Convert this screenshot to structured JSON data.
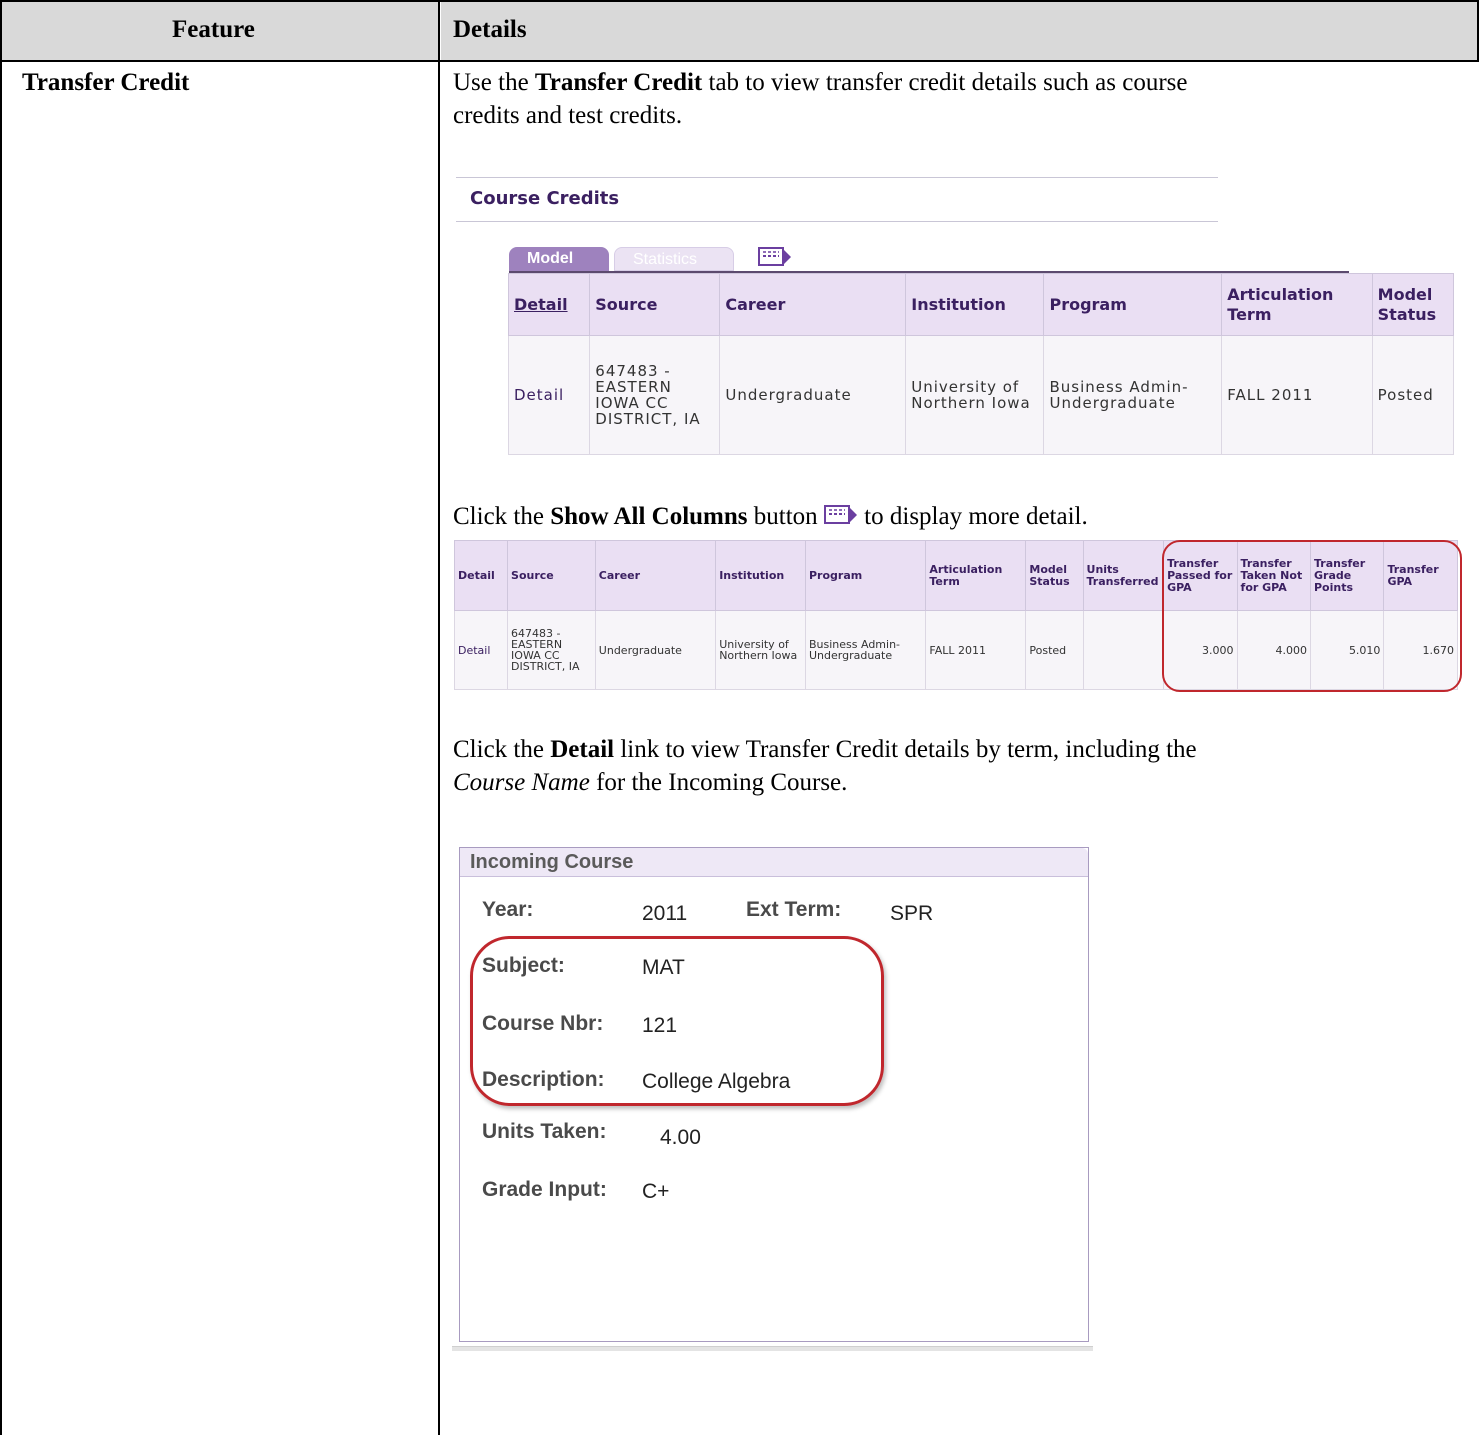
{
  "doc_table": {
    "header_feature": "Feature",
    "header_details": "Details",
    "feature_name": "Transfer Credit"
  },
  "intro": {
    "p1_a": "Use the ",
    "p1_b": "Transfer Credit",
    "p1_c": " tab to view transfer credit details such as course",
    "p1_line2": "credits and test credits."
  },
  "course_credits": {
    "section_title": "Course Credits",
    "tabs": [
      {
        "label": "Model",
        "active": true
      },
      {
        "label": "Statistics",
        "active": false
      }
    ],
    "icon": "show-all-columns-icon",
    "columns": [
      "Detail",
      "Source",
      "Career",
      "Institution",
      "Program",
      "Articulation Term",
      "Model Status"
    ],
    "row": {
      "detail": "Detail",
      "source": "647483 - EASTERN IOWA CC DISTRICT, IA",
      "career": "Undergraduate",
      "institution": "University of Northern Iowa",
      "program": "Business Admin-Undergraduate",
      "articulation_term": "FALL 2011",
      "model_status": "Posted"
    }
  },
  "show_all": {
    "text_a": "Click the ",
    "text_b": "Show All Columns",
    "text_c": " button ",
    "text_d": " to display more detail."
  },
  "expanded_table": {
    "columns": [
      "Detail",
      "Source",
      "Career",
      "Institution",
      "Program",
      "Articulation Term",
      "Model Status",
      "Units Transferred",
      "Transfer Passed for GPA",
      "Transfer Taken Not for GPA",
      "Transfer Grade Points",
      "Transfer GPA"
    ],
    "row": {
      "detail": "Detail",
      "source": "647483 - EASTERN IOWA CC DISTRICT, IA",
      "career": "Undergraduate",
      "institution": "University of Northern Iowa",
      "program": "Business Admin-Undergraduate",
      "articulation_term": "FALL 2011",
      "model_status": "Posted",
      "units_transferred": "",
      "passed_for_gpa": "3.000",
      "taken_not_for_gpa": "4.000",
      "grade_points": "5.010",
      "gpa": "1.670"
    },
    "highlight_color": "#c0272d"
  },
  "detail_text": {
    "a": "Click the ",
    "b": "Detail",
    "c": " link to view Transfer Credit details by term, including the",
    "d": "Course Name",
    "e": " for the Incoming Course."
  },
  "incoming_course": {
    "title": "Incoming Course",
    "year_label": "Year:",
    "year": "2011",
    "ext_term_label": "Ext Term:",
    "ext_term": "SPR",
    "subject_label": "Subject:",
    "subject": "MAT",
    "course_nbr_label": "Course Nbr:",
    "course_nbr": "121",
    "description_label": "Description:",
    "description": "College Algebra",
    "units_taken_label": "Units Taken:",
    "units_taken": "4.00",
    "grade_input_label": "Grade Input:",
    "grade_input": "C+"
  }
}
